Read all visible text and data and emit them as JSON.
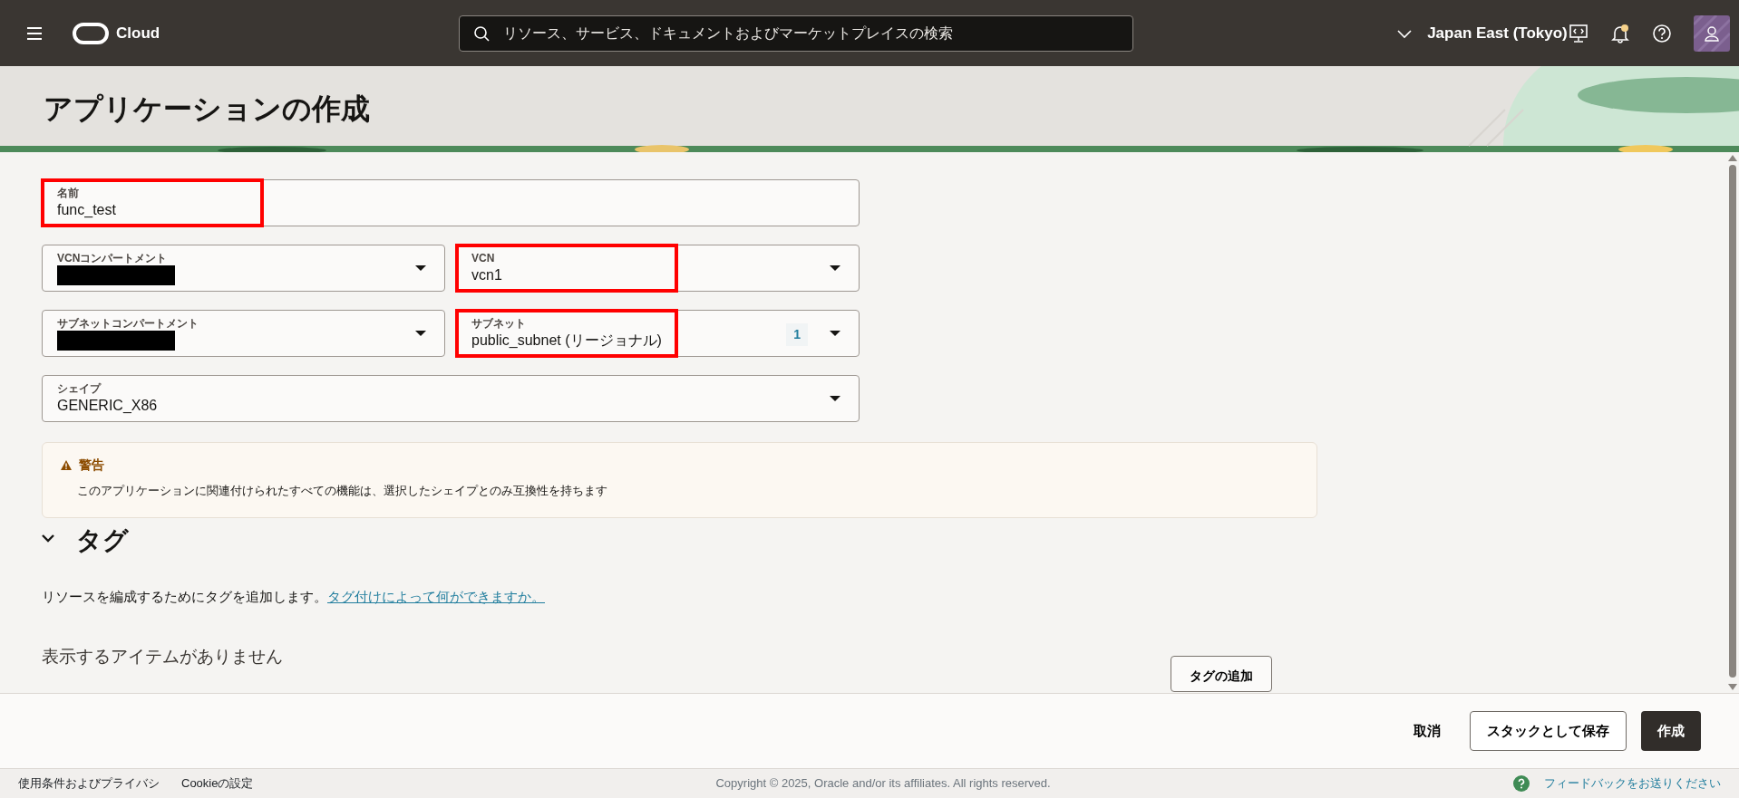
{
  "header": {
    "brand": "Cloud",
    "search": {
      "placeholder": "リソース、サービス、ドキュメントおよびマーケットプレイスの検索"
    },
    "region": "Japan East (Tokyo)",
    "unread_notifications": true
  },
  "page": {
    "title": "アプリケーションの作成"
  },
  "form": {
    "rows": [
      {
        "fields": [
          {
            "kind": "text",
            "label": "名前",
            "value": "func_test",
            "highlighted": true
          }
        ]
      },
      {
        "fields": [
          {
            "kind": "select",
            "label": "VCNコンパートメント",
            "redacted": true
          },
          {
            "kind": "select",
            "label": "VCN",
            "value": "vcn1",
            "highlighted": true
          }
        ]
      },
      {
        "fields": [
          {
            "kind": "select",
            "label": "サブネットコンパートメント",
            "redacted": true
          },
          {
            "kind": "select",
            "label": "サブネット",
            "value": "public_subnet (リージョナル)",
            "count": "1",
            "highlighted": true
          }
        ]
      },
      {
        "fields": [
          {
            "kind": "select",
            "label": "シェイプ",
            "value": "GENERIC_X86"
          }
        ]
      }
    ]
  },
  "warning": {
    "title": "警告",
    "message": "このアプリケーションに関連付けられたすべての機能は、選択したシェイプとのみ互換性を持ちます"
  },
  "tags": {
    "heading": "タグ",
    "expanded": true,
    "description": "リソースを編成するためにタグを追加します。",
    "link": "タグ付けによって何ができますか。",
    "empty_message": "表示するアイテムがありません",
    "add_button": "タグの追加"
  },
  "actions": [
    {
      "kind": "link",
      "label": "取消"
    },
    {
      "kind": "outline",
      "label": "スタックとして保存"
    },
    {
      "kind": "primary",
      "label": "作成"
    }
  ],
  "footer": {
    "links": [
      "使用条件およびプライバシ",
      "Cookieの設定"
    ],
    "copyright": "Copyright © 2025, Oracle and/or its affiliates. All rights reserved.",
    "feedback": "フィードバックをお送りください"
  }
}
